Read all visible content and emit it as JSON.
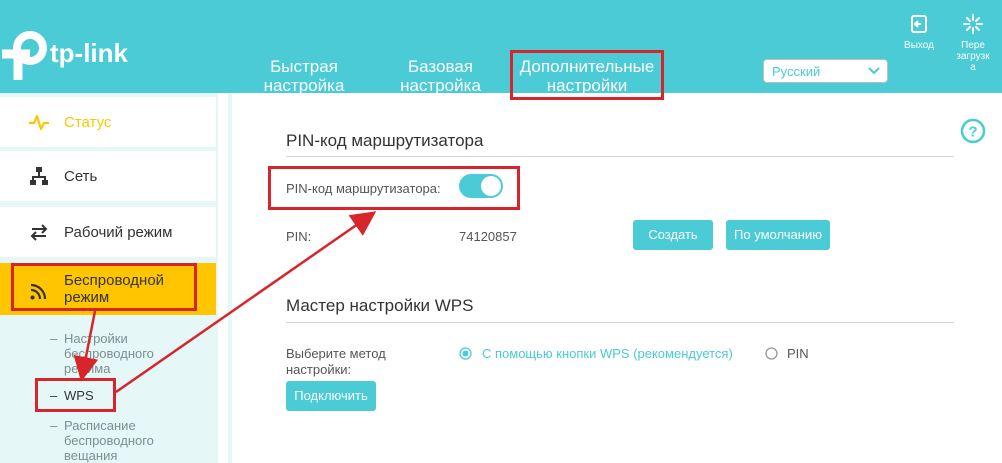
{
  "header": {
    "brand": "tp-link",
    "nav": {
      "quick_line1": "Быстрая",
      "quick_line2": "настройка",
      "basic_line1": "Базовая",
      "basic_line2": "настройка",
      "advanced_line1": "Дополнительные",
      "advanced_line2": "настройки"
    },
    "language": {
      "selected": "Русский"
    },
    "logout_label": "Выход",
    "reboot_label_line1": "Пере",
    "reboot_label_line2": "загрузк",
    "reboot_label_line3": "а"
  },
  "sidebar": {
    "items": [
      {
        "label": "Статус",
        "icon": "pulse-icon"
      },
      {
        "label": "Сеть",
        "icon": "network-icon"
      },
      {
        "label": "Рабочий режим",
        "icon": "mode-switch-icon"
      },
      {
        "label_line1": "Беспроводной",
        "label_line2": "режим",
        "icon": "wifi-icon"
      }
    ],
    "sub_items": [
      {
        "dash": "–",
        "line1": "Настройки",
        "line2": "беспроводного",
        "line3": "режима"
      },
      {
        "dash": "–",
        "line1": "WPS"
      },
      {
        "dash": "–",
        "line1": "Расписание",
        "line2": "беспроводного",
        "line3": "вещания"
      }
    ]
  },
  "main": {
    "pin_section": {
      "title": "PIN-код маршрутизатора",
      "toggle_label": "PIN-код маршрутизатора:",
      "toggle_on": true,
      "pin_label": "PIN:",
      "pin_value": "74120857",
      "create_button": "Создать",
      "default_button": "По умолчанию"
    },
    "wps_section": {
      "title": "Мастер настройки WPS",
      "method_label_line1": "Выберите метод",
      "method_label_line2": "настройки:",
      "option_button": "С помощью кнопки WPS (рекомендуется)",
      "option_pin": "PIN",
      "selected_option": "button",
      "connect_button": "Подключить"
    }
  },
  "colors": {
    "accent": "#4acbd6",
    "highlight": "#ffc600",
    "annotation": "#d8242b"
  }
}
